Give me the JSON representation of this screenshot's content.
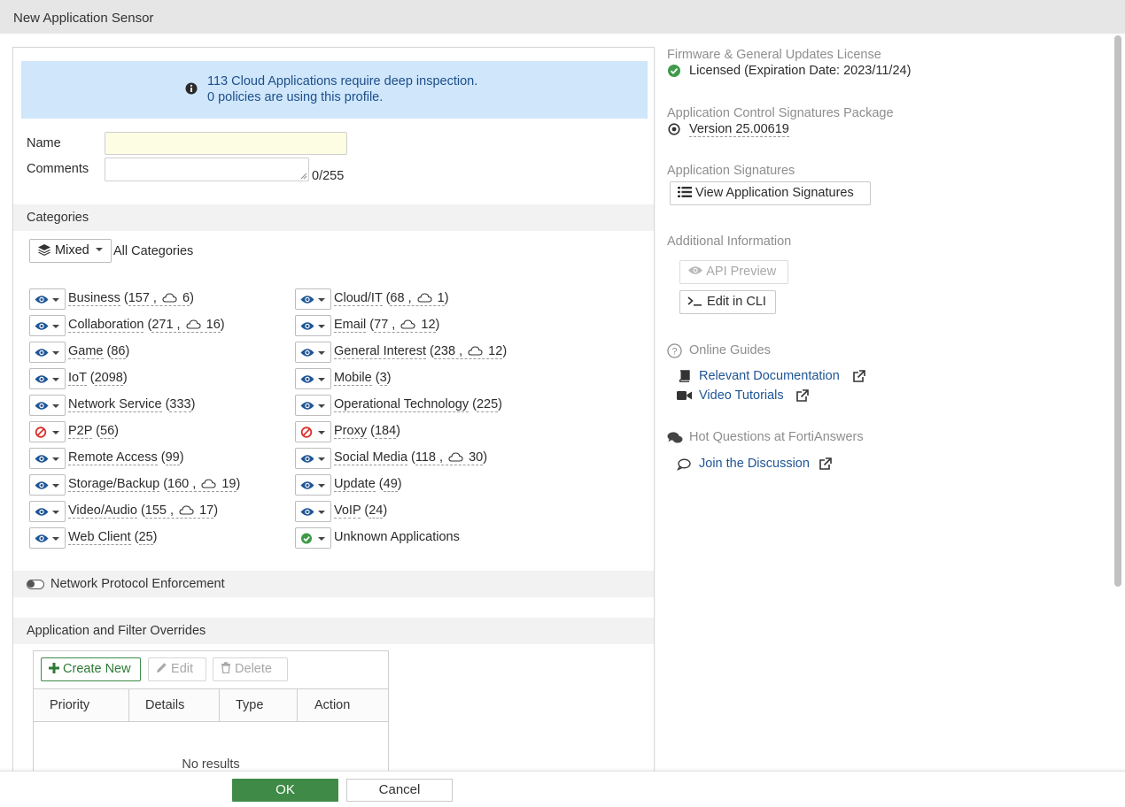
{
  "window": {
    "title": "New Application Sensor"
  },
  "banner": {
    "line1": "113 Cloud Applications require deep inspection.",
    "line2": "0 policies are using this profile."
  },
  "form": {
    "name_label": "Name",
    "name_value": "",
    "comments_label": "Comments",
    "comments_value": "",
    "comments_counter": "0/255"
  },
  "categories": {
    "header": "Categories",
    "mixed_label": "Mixed",
    "all_label": "All Categories",
    "items": [
      {
        "name": "Business",
        "count": "157",
        "cloud": "6",
        "action": "monitor"
      },
      {
        "name": "Collaboration",
        "count": "271",
        "cloud": "16",
        "action": "monitor"
      },
      {
        "name": "Game",
        "count": "86",
        "cloud": null,
        "action": "monitor"
      },
      {
        "name": "IoT",
        "count": "2098",
        "cloud": null,
        "action": "monitor"
      },
      {
        "name": "Network Service",
        "count": "333",
        "cloud": null,
        "action": "monitor"
      },
      {
        "name": "P2P",
        "count": "56",
        "cloud": null,
        "action": "block"
      },
      {
        "name": "Remote Access",
        "count": "99",
        "cloud": null,
        "action": "monitor"
      },
      {
        "name": "Storage/Backup",
        "count": "160",
        "cloud": "19",
        "action": "monitor"
      },
      {
        "name": "Video/Audio",
        "count": "155",
        "cloud": "17",
        "action": "monitor"
      },
      {
        "name": "Web Client",
        "count": "25",
        "cloud": null,
        "action": "monitor"
      },
      {
        "name": "Cloud/IT",
        "count": "68",
        "cloud": "1",
        "action": "monitor"
      },
      {
        "name": "Email",
        "count": "77",
        "cloud": "12",
        "action": "monitor"
      },
      {
        "name": "General Interest",
        "count": "238",
        "cloud": "12",
        "action": "monitor"
      },
      {
        "name": "Mobile",
        "count": "3",
        "cloud": null,
        "action": "monitor"
      },
      {
        "name": "Operational Technology",
        "count": "225",
        "cloud": null,
        "action": "monitor"
      },
      {
        "name": "Proxy",
        "count": "184",
        "cloud": null,
        "action": "block"
      },
      {
        "name": "Social Media",
        "count": "118",
        "cloud": "30",
        "action": "monitor"
      },
      {
        "name": "Update",
        "count": "49",
        "cloud": null,
        "action": "monitor"
      },
      {
        "name": "VoIP",
        "count": "24",
        "cloud": null,
        "action": "monitor"
      },
      {
        "name": "Unknown Applications",
        "count": null,
        "cloud": null,
        "action": "allow"
      }
    ]
  },
  "protocol": {
    "label": "Network Protocol Enforcement",
    "enabled": false
  },
  "overrides": {
    "header": "Application and Filter Overrides",
    "create_label": "Create New",
    "edit_label": "Edit",
    "delete_label": "Delete",
    "columns": [
      "Priority",
      "Details",
      "Type",
      "Action"
    ],
    "empty_text": "No results"
  },
  "sidebar": {
    "license_heading": "Firmware & General Updates License",
    "license_status": "Licensed (Expiration Date: 2023/11/24)",
    "package_heading": "Application Control Signatures Package",
    "package_version": "Version 25.00619",
    "signatures_heading": "Application Signatures",
    "view_signatures": "View Application Signatures",
    "additional_heading": "Additional Information",
    "api_preview": "API Preview",
    "edit_cli": "Edit in CLI",
    "guides_heading": "Online Guides",
    "relevant_docs": "Relevant Documentation",
    "video_tutorials": "Video Tutorials",
    "hot_questions": "Hot Questions at FortiAnswers",
    "join_discussion": "Join the Discussion"
  },
  "footer": {
    "ok": "OK",
    "cancel": "Cancel"
  },
  "colors": {
    "accent_green": "#3f8a47",
    "link_blue": "#1e5596",
    "banner_bg": "#cfe6fb",
    "block_red": "#d9322e"
  }
}
